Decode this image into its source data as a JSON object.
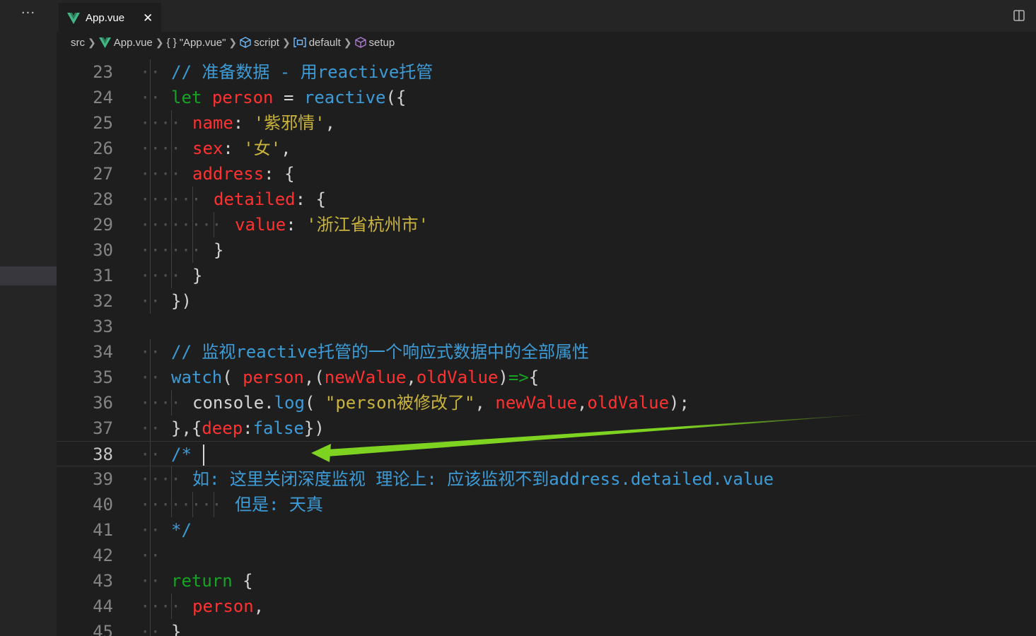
{
  "sidebar": {
    "more_label": "···"
  },
  "tabs": [
    {
      "label": "App.vue",
      "close": "✕"
    }
  ],
  "breadcrumb": {
    "src": "src",
    "file": "App.vue",
    "block": "\"App.vue\"",
    "script": "script",
    "default": "default",
    "setup": "setup"
  },
  "editor": {
    "active_line": 38,
    "lines": [
      {
        "n": "23",
        "text": "// 准备数据 - 用reactive托管"
      },
      {
        "n": "24",
        "text": "let person = reactive({"
      },
      {
        "n": "25",
        "text": "name: '紫邪情',"
      },
      {
        "n": "26",
        "text": "sex: '女',"
      },
      {
        "n": "27",
        "text": "address: {"
      },
      {
        "n": "28",
        "text": "detailed: {"
      },
      {
        "n": "29",
        "text": "value: '浙江省杭州市'"
      },
      {
        "n": "30",
        "text": "}"
      },
      {
        "n": "31",
        "text": "}"
      },
      {
        "n": "32",
        "text": "})"
      },
      {
        "n": "33",
        "text": ""
      },
      {
        "n": "34",
        "text": "// 监视reactive托管的一个响应式数据中的全部属性"
      },
      {
        "n": "35",
        "text": "watch( person,(newValue,oldValue)=>{"
      },
      {
        "n": "36",
        "text": "console.log( \"person被修改了\", newValue,oldValue);"
      },
      {
        "n": "37",
        "text": "},{deep:false})"
      },
      {
        "n": "38",
        "text": "/* "
      },
      {
        "n": "39",
        "text": "如: 这里关闭深度监视 理论上: 应该监视不到address.detailed.value"
      },
      {
        "n": "40",
        "text": "但是: 天真"
      },
      {
        "n": "41",
        "text": "*/"
      },
      {
        "n": "42",
        "text": ""
      },
      {
        "n": "43",
        "text": "return {"
      },
      {
        "n": "44",
        "text": "person,"
      },
      {
        "n": "45",
        "text": "}"
      }
    ]
  },
  "annotation": {
    "arrow_color": "#7ed321"
  },
  "colors": {
    "keyword": "#17a324",
    "variable": "#ff3131",
    "function": "#3d9bd6",
    "string": "#c9b33c",
    "comment": "#3d9bd6"
  }
}
